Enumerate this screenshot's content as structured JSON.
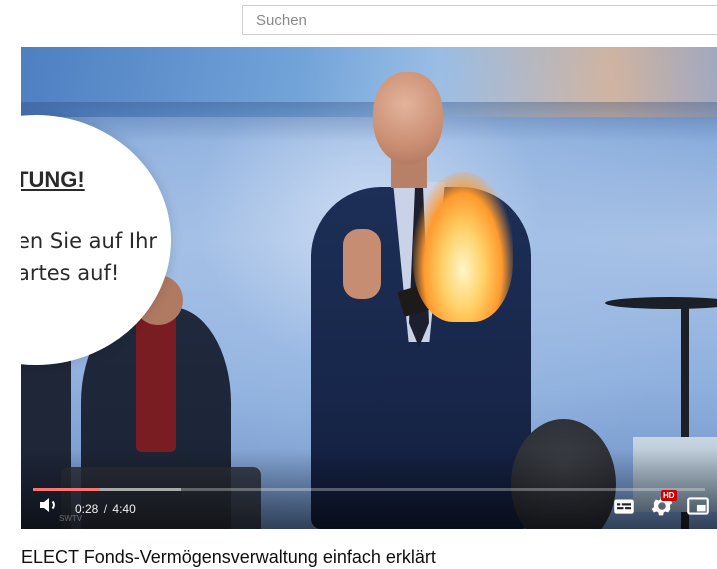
{
  "search": {
    "placeholder": "Suchen",
    "value": ""
  },
  "player": {
    "slide": {
      "heading": "TUNG!",
      "line1": "en Sie auf Ihr",
      "line2": "artes auf!"
    },
    "current_time": "0:28",
    "time_separator": "/",
    "duration": "4:40",
    "progress": 0.1,
    "hd_badge": "HD",
    "watermark": "SWTV",
    "colors": {
      "progress": "#ff0000",
      "hd_badge": "#cc0000"
    },
    "icons": [
      "volume-icon",
      "subtitles-icon",
      "settings-icon",
      "miniplayer-icon"
    ]
  },
  "video": {
    "title": "ELECT Fonds-Vermögensverwaltung einfach erklärt"
  }
}
